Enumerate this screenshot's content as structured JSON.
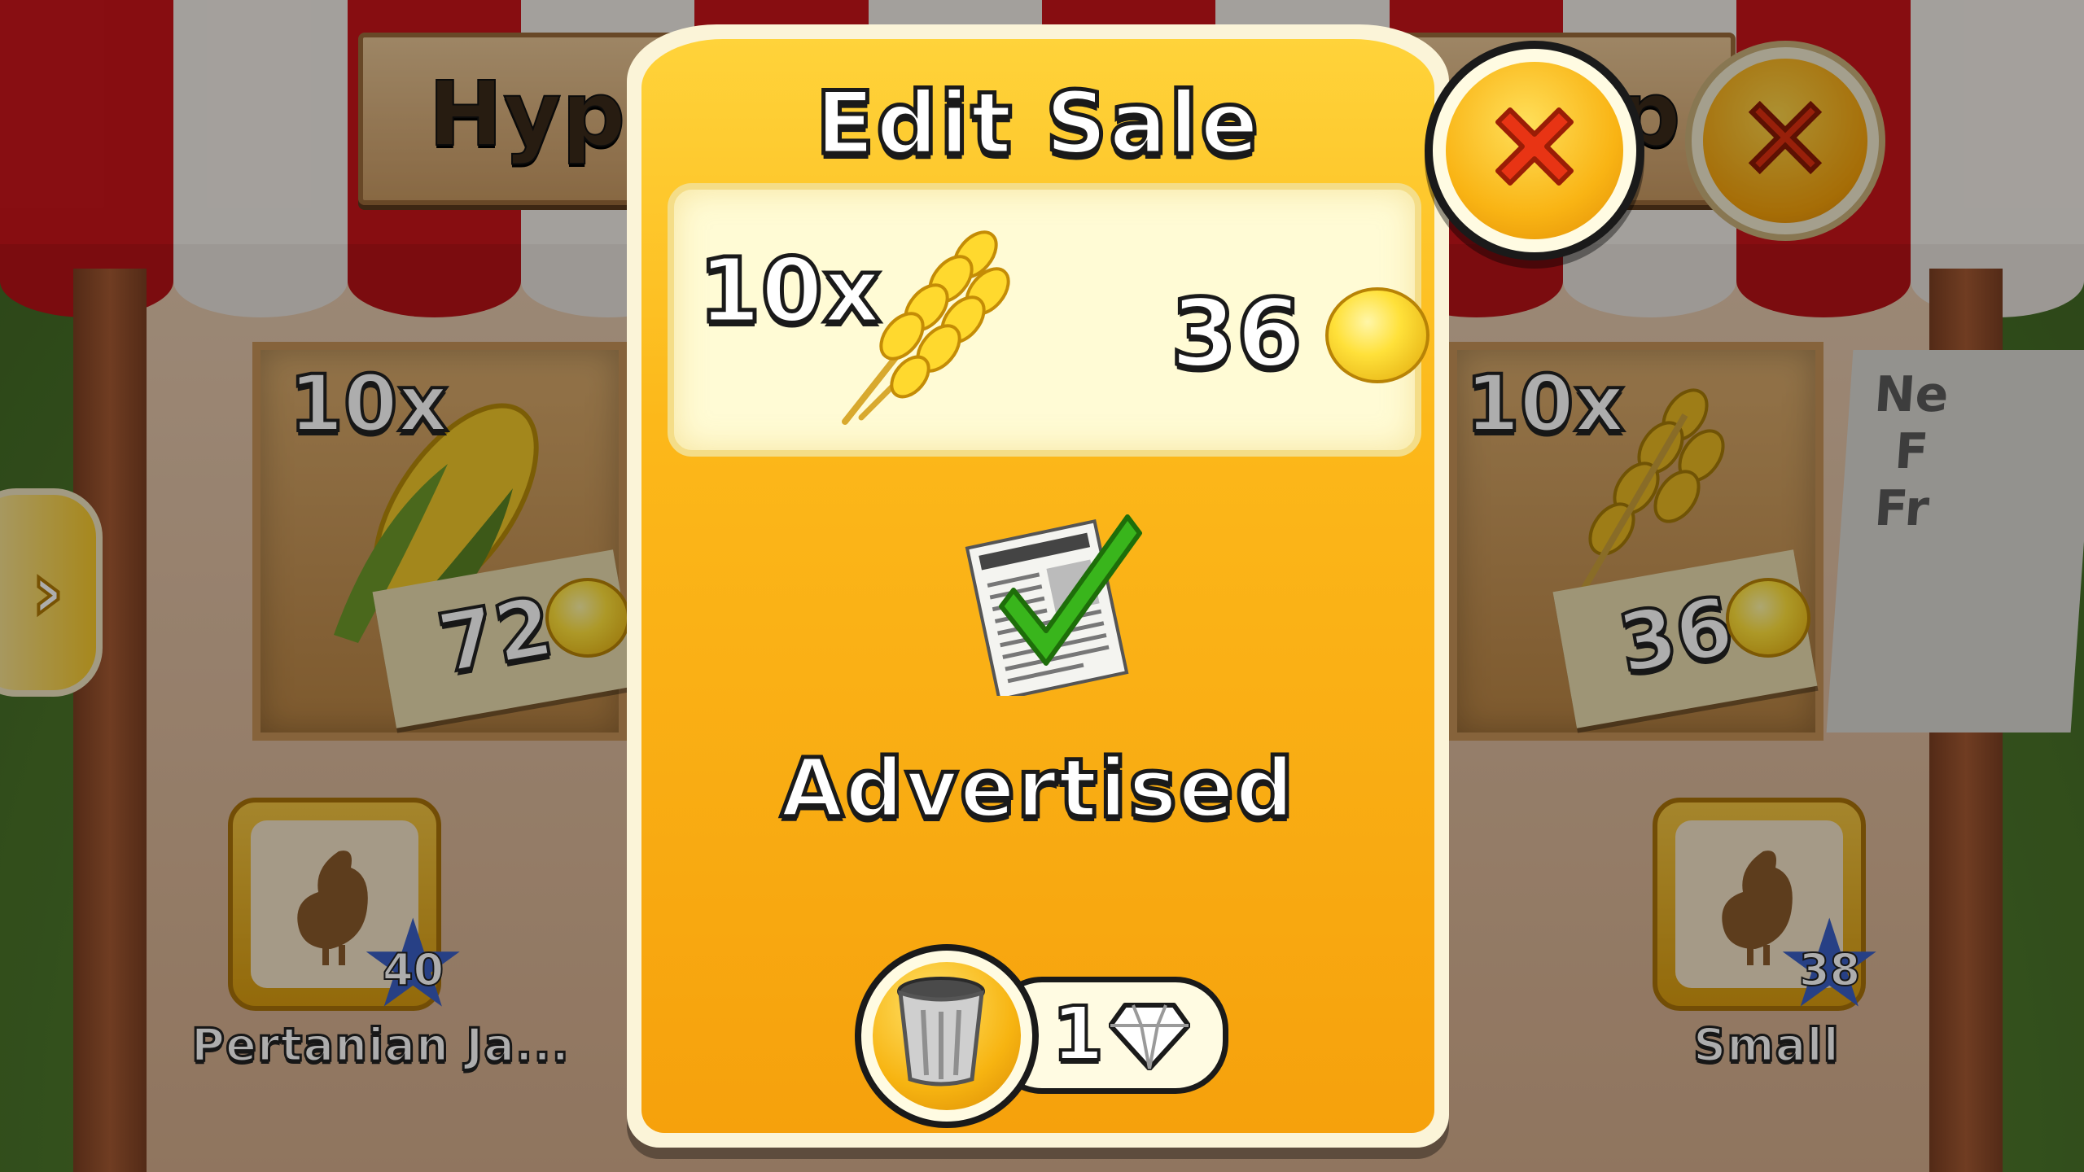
{
  "modal": {
    "title": "Edit Sale",
    "item": {
      "quantity": "10x",
      "icon": "wheat-icon",
      "price": "36",
      "currency_icon": "coin-icon"
    },
    "status_icon": "advertised-newspaper-check-icon",
    "status_label": "Advertised",
    "delete": {
      "icon": "trash-can-icon",
      "cost": "1",
      "cost_icon": "diamond-icon"
    },
    "close_icon": "close-x-icon"
  },
  "background": {
    "sign_left_partial": "Hypnot",
    "sign_right_partial": "p",
    "left_slot": {
      "quantity": "10x",
      "icon": "corn-icon",
      "price": "72"
    },
    "right_slot": {
      "quantity": "10x",
      "icon": "wheat-icon",
      "price": "36"
    },
    "newspaper_partial_lines": [
      "Ne",
      "F",
      "Fr"
    ],
    "left_friend": {
      "name": "Pertanian Ja...",
      "level": "40"
    },
    "right_friend": {
      "name": "Small",
      "level": "38"
    }
  },
  "colors": {
    "modal_yellow": "#fcb81a",
    "close_red": "#e03010",
    "check_green": "#39b51c",
    "awning_red": "#c8141a"
  }
}
